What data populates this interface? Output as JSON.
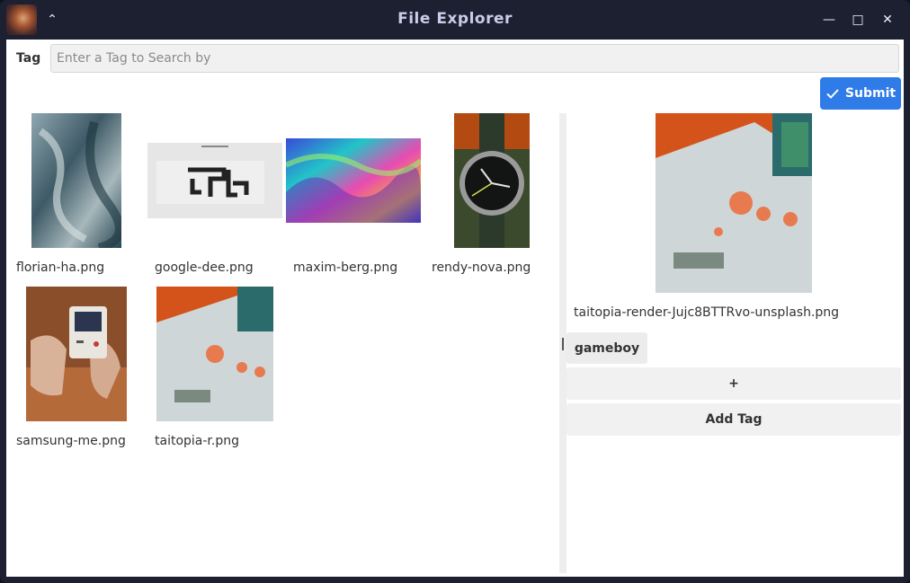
{
  "window": {
    "title": "File Explorer",
    "collapse_icon": "chevron-up-icon",
    "minimize_icon": "minimize-icon",
    "maximize_icon": "maximize-icon",
    "close_icon": "close-icon",
    "collapse_glyph": "⌃",
    "minimize_glyph": "—",
    "maximize_glyph": "□",
    "close_glyph": "✕"
  },
  "search": {
    "label": "Tag",
    "placeholder": "Enter a Tag to Search by",
    "value": "",
    "submit_label": "Submit",
    "submit_icon": "check-icon",
    "accent": "#2f7be8"
  },
  "files": [
    {
      "name": "florian-ha.png",
      "thumb_icon": "photo-icon"
    },
    {
      "name": "google-dee.png",
      "thumb_icon": "photo-icon"
    },
    {
      "name": "maxim-berg.png",
      "thumb_icon": "photo-icon"
    },
    {
      "name": "rendy-nova.png",
      "thumb_icon": "photo-icon"
    },
    {
      "name": "samsung-me.png",
      "thumb_icon": "photo-icon"
    },
    {
      "name": "taitopia-r.png",
      "thumb_icon": "photo-icon"
    }
  ],
  "preview": {
    "file_name": "taitopia-render-Jujc8BTTRvo-unsplash.png",
    "tags": [
      "gameboy"
    ],
    "add_button_label": "+",
    "add_tag_label": "Add Tag"
  }
}
